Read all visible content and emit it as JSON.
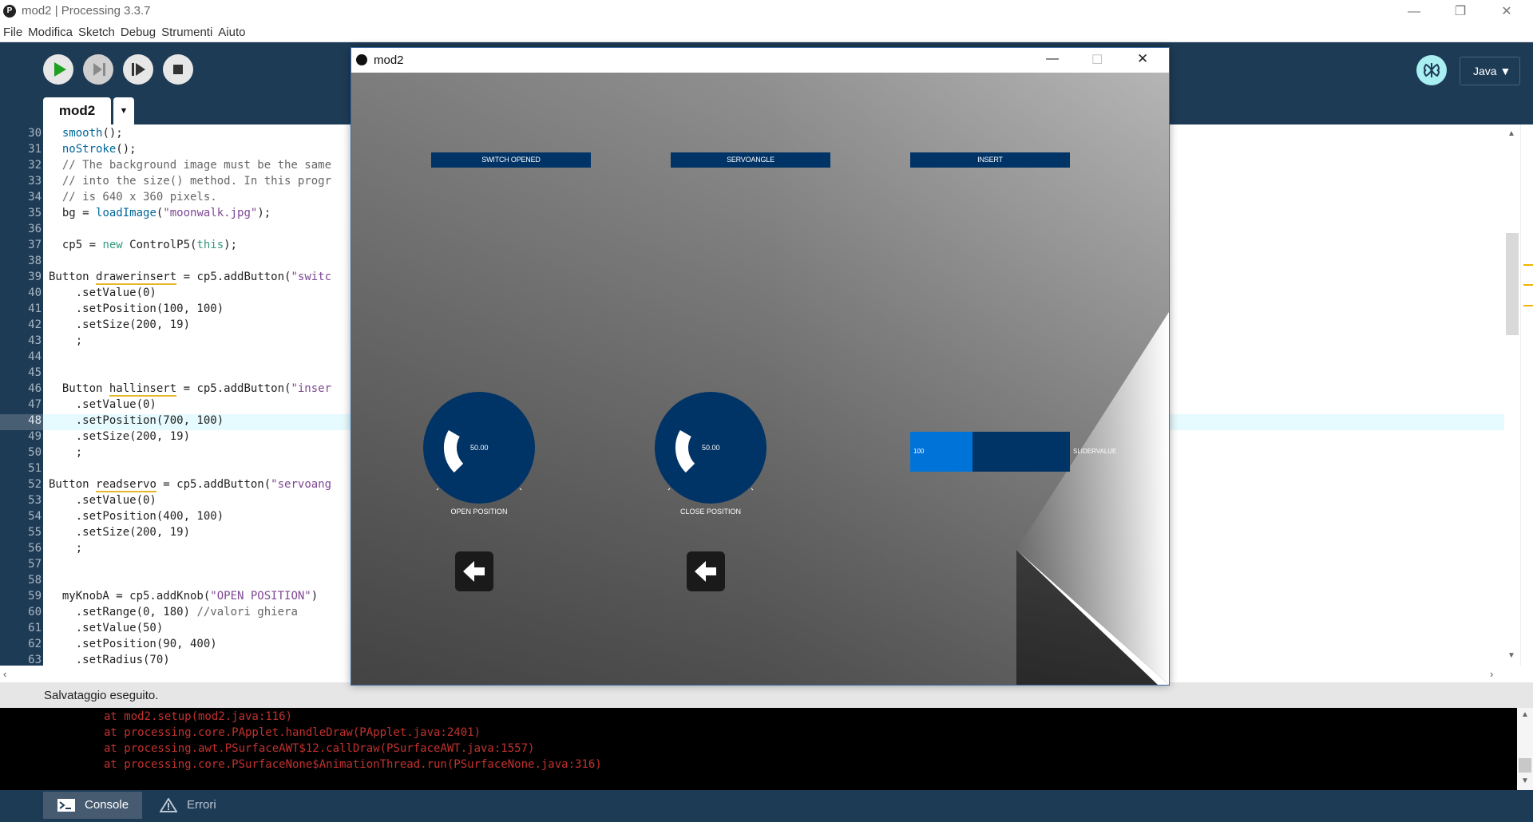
{
  "window": {
    "title": "mod2 | Processing 3.3.7",
    "controls": {
      "minimize": "—",
      "restore": "❐",
      "close": "✕"
    }
  },
  "menu": [
    "File",
    "Modifica",
    "Sketch",
    "Debug",
    "Strumenti",
    "Aiuto"
  ],
  "toolbar": {
    "mode": "Java ▼",
    "tab_name": "mod2",
    "tab_arrow": "▼"
  },
  "editor": {
    "line_numbers": [
      "30",
      "31",
      "32",
      "33",
      "34",
      "35",
      "36",
      "37",
      "38",
      "39",
      "40",
      "41",
      "42",
      "43",
      "44",
      "45",
      "46",
      "47",
      "48",
      "49",
      "50",
      "51",
      "52",
      "53",
      "54",
      "55",
      "56",
      "57",
      "58",
      "59",
      "60",
      "61",
      "62",
      "63"
    ],
    "current_line": "48"
  },
  "status": {
    "message": "Salvataggio eseguito."
  },
  "console": {
    "lines": [
      "at mod2.setup(mod2.java:116)",
      "at processing.core.PApplet.handleDraw(PApplet.java:2401)",
      "at processing.awt.PSurfaceAWT$12.callDraw(PSurfaceAWT.java:1557)",
      "at processing.core.PSurfaceNone$AnimationThread.run(PSurfaceNone.java:316)"
    ],
    "tabs": {
      "console": "Console",
      "errors": "Errori"
    }
  },
  "sketch": {
    "title": "mod2",
    "buttons": [
      "SWITCH OPENED",
      "SERVOANGLE",
      "INSERT"
    ],
    "knob_a": {
      "value": "50.00",
      "label": "OPEN POSITION",
      "range": [
        0,
        180
      ],
      "level": 50
    },
    "knob_b": {
      "value": "50.00",
      "label": "CLOSE POSITION",
      "range": [
        0,
        180
      ],
      "level": 50
    },
    "slider": {
      "value": "100",
      "label": "SLIDERVALUE"
    }
  },
  "colors": {
    "toolbar_bg": "#1e3b55",
    "control_bg": "#003366",
    "slider_fill": "#0073d9",
    "console_text": "#c2312f",
    "mode_button": "#a9eef1"
  }
}
